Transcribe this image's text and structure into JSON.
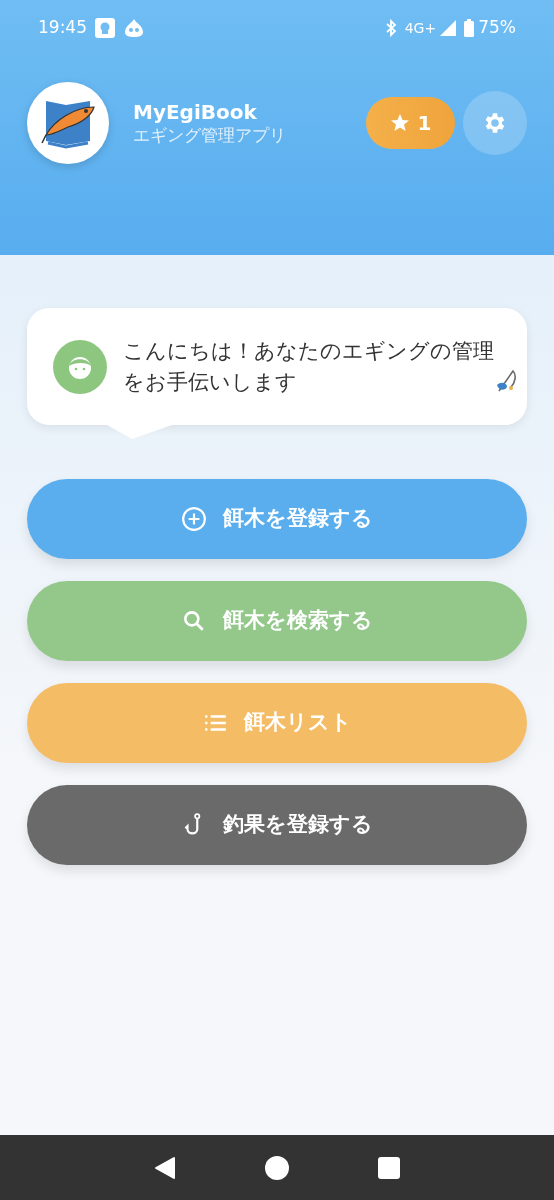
{
  "status_bar": {
    "time": "19:45",
    "network": "4G+",
    "battery": "75%"
  },
  "header": {
    "title": "MyEgiBook",
    "subtitle": "エギング管理アプリ",
    "badge": "1"
  },
  "greeting": {
    "text": "こんにちは！あなたのエギングの管理をお手伝いします"
  },
  "actions": [
    {
      "label": "餌木を登録する",
      "kind": "add",
      "color": "#5aaeee"
    },
    {
      "label": "餌木を検索する",
      "kind": "search",
      "color": "#93c88a"
    },
    {
      "label": "餌木リスト",
      "kind": "list",
      "color": "#f4bc65"
    },
    {
      "label": "釣果を登録する",
      "kind": "hook",
      "color": "#6a6a6a"
    }
  ]
}
